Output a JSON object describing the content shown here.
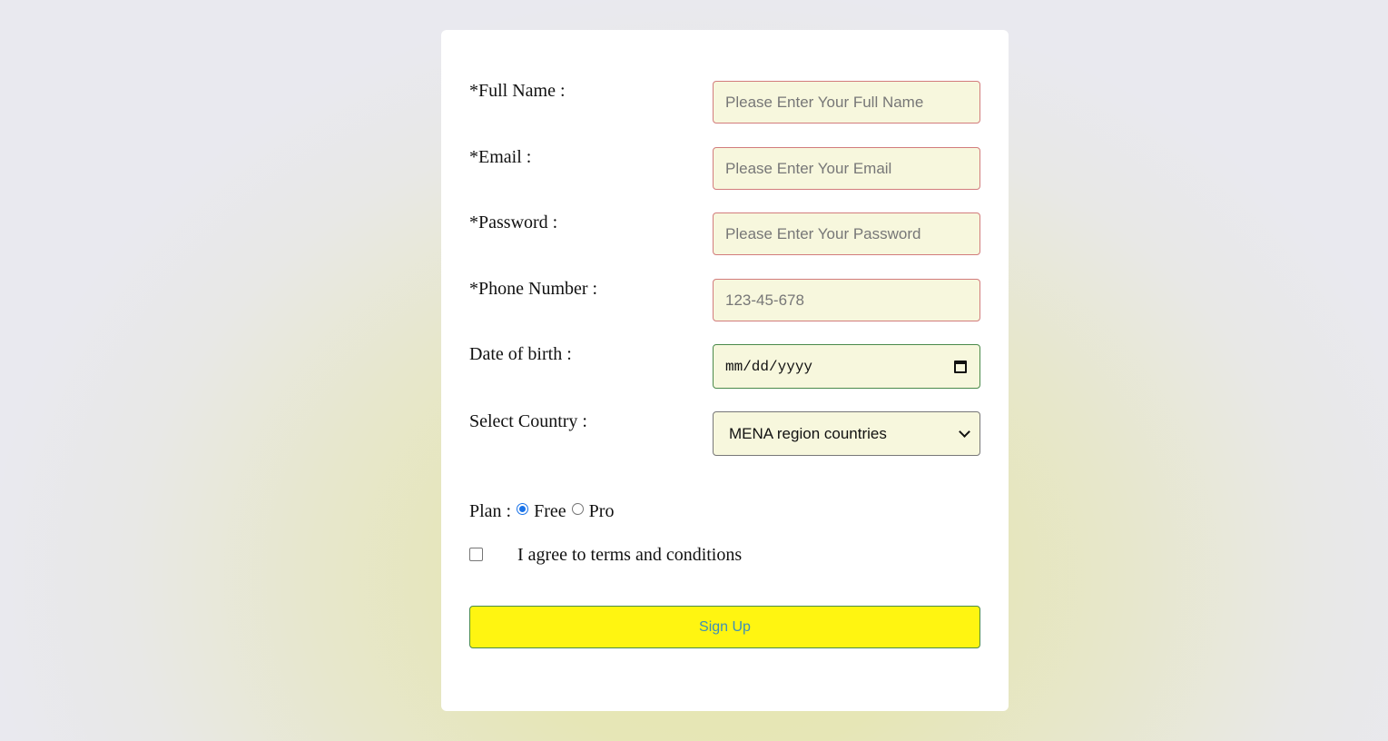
{
  "form": {
    "full_name": {
      "label": "*Full Name :",
      "placeholder": "Please Enter Your Full Name"
    },
    "email": {
      "label": "*Email :",
      "placeholder": "Please Enter Your Email"
    },
    "password": {
      "label": "*Password :",
      "placeholder": "Please Enter Your Password"
    },
    "phone": {
      "label": "*Phone Number :",
      "placeholder": "123-45-678"
    },
    "dob": {
      "label": "Date of birth :",
      "placeholder": "mm/dd/yyyy",
      "icon": "calendar-icon"
    },
    "country": {
      "label": "Select Country :",
      "selected": "MENA region countries",
      "icon": "chevron-down-icon"
    },
    "plan": {
      "label": "Plan :",
      "options": [
        {
          "label": "Free",
          "checked": true
        },
        {
          "label": "Pro",
          "checked": false
        }
      ]
    },
    "terms": {
      "label": "I agree to terms and conditions",
      "checked": false
    },
    "submit_label": "Sign Up"
  },
  "colors": {
    "field_bg": "#f7f7dd",
    "required_border": "#d27c7c",
    "valid_border": "#4a8a4a",
    "button_bg": "#fff511",
    "button_text": "#3d8fb8",
    "radio_accent": "#1a73e8"
  }
}
